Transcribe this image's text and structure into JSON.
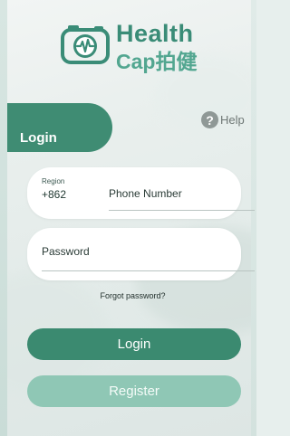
{
  "logo": {
    "line1": "Health",
    "line2": "Cap拍健",
    "icon": "camera-heartbeat-icon"
  },
  "tab": {
    "label": "Login"
  },
  "help": {
    "icon": "question-icon",
    "glyph": "?",
    "label": "Help"
  },
  "phone": {
    "region_label": "Region",
    "region_code": "+862",
    "placeholder": "Phone Number",
    "value": ""
  },
  "password": {
    "placeholder": "Password",
    "value": ""
  },
  "forgot_password": "Forgot password?",
  "buttons": {
    "login": "Login",
    "register": "Register"
  },
  "colors": {
    "primary": "#3b8a70",
    "secondary": "#8fc7b5",
    "logo": "#3a8c77",
    "background": "#e9efed"
  }
}
